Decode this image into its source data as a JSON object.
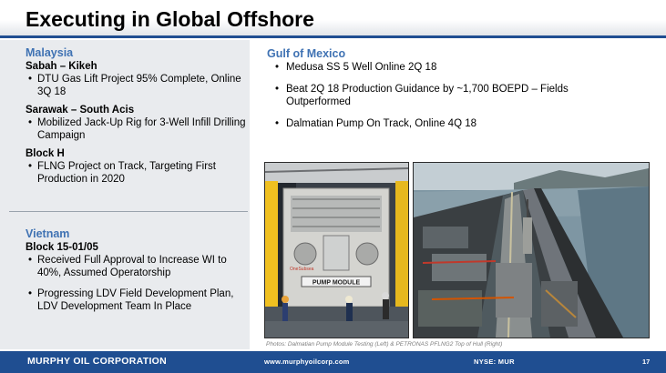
{
  "title": "Executing in Global Offshore",
  "malaysia": {
    "region": "Malaysia",
    "groups": [
      {
        "name": "Sabah – Kikeh",
        "bullets": [
          "DTU Gas Lift Project 95% Complete, Online 3Q 18"
        ]
      },
      {
        "name": "Sarawak – South Acis",
        "bullets": [
          "Mobilized Jack-Up Rig for 3-Well Infill Drilling Campaign"
        ]
      },
      {
        "name": "Block H",
        "bullets": [
          "FLNG Project on Track, Targeting First Production in 2020"
        ]
      }
    ]
  },
  "vietnam": {
    "region": "Vietnam",
    "group": "Block 15-01/05",
    "bullets": [
      "Received Full Approval to Increase WI to 40%, Assumed Operatorship",
      "Progressing LDV Field Development Plan, LDV Development Team In Place"
    ]
  },
  "gulf_of_mexico": {
    "region": "Gulf of Mexico",
    "bullets": [
      "Medusa SS 5 Well Online 2Q 18",
      "Beat 2Q 18 Production Guidance by ~1,700 BOEPD – Fields Outperformed",
      "Dalmatian Pump On Track, Online 4Q 18"
    ]
  },
  "photos": {
    "left_sign": "PUMP MODULE",
    "left_logo": "OneSubsea",
    "caption": "Photos: Dalmatian Pump Module Testing (Left) & PETRONAS PFLNG2 Top of Hull (Right)"
  },
  "bullet_char": "•",
  "footer": {
    "company": "MURPHY OIL CORPORATION",
    "url": "www.murphyoilcorp.com",
    "ticker": "NYSE: MUR",
    "page": "17"
  },
  "colors": {
    "brand_blue": "#1f4e91",
    "region_blue": "#3f72b3",
    "panel_gray": "#e9ebee"
  }
}
